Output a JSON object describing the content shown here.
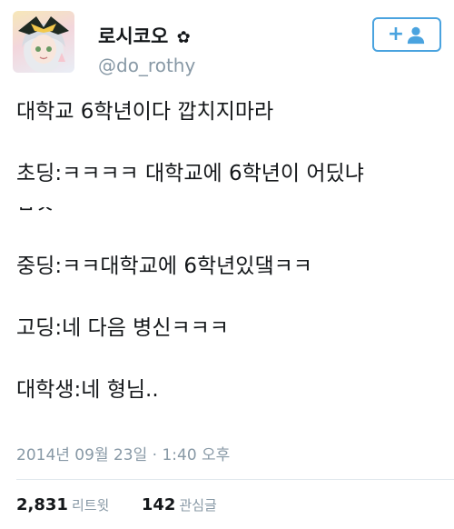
{
  "user": {
    "display_name": "로시코오",
    "name_icon": "flower-icon",
    "handle": "@do_rothy",
    "avatar": "anime-avatar-image"
  },
  "follow_button": {
    "plus": "+",
    "icon": "person-icon",
    "accent": "#4aa3df"
  },
  "tweet": {
    "lines": [
      "대학교 6학년이다 깝치지마라",
      "초딩:ㅋㅋㅋㅋ 대학교에 6학년이 어딨냐",
      "ㅂㅅ",
      "중딩:ㅋㅋ대학교에 6학년있댘ㅋㅋ",
      "고딩:네 다음 병신ㅋㅋㅋ",
      "대학생:네 형님.."
    ],
    "timestamp": "2014년 09월 23일 · 1:40 오후"
  },
  "stats": {
    "retweets_count": "2,831",
    "retweets_label": "리트윗",
    "likes_count": "142",
    "likes_label": "관심글"
  },
  "colors": {
    "text": "#14171a",
    "muted": "#8899a6",
    "divider": "#e1e8ed"
  }
}
